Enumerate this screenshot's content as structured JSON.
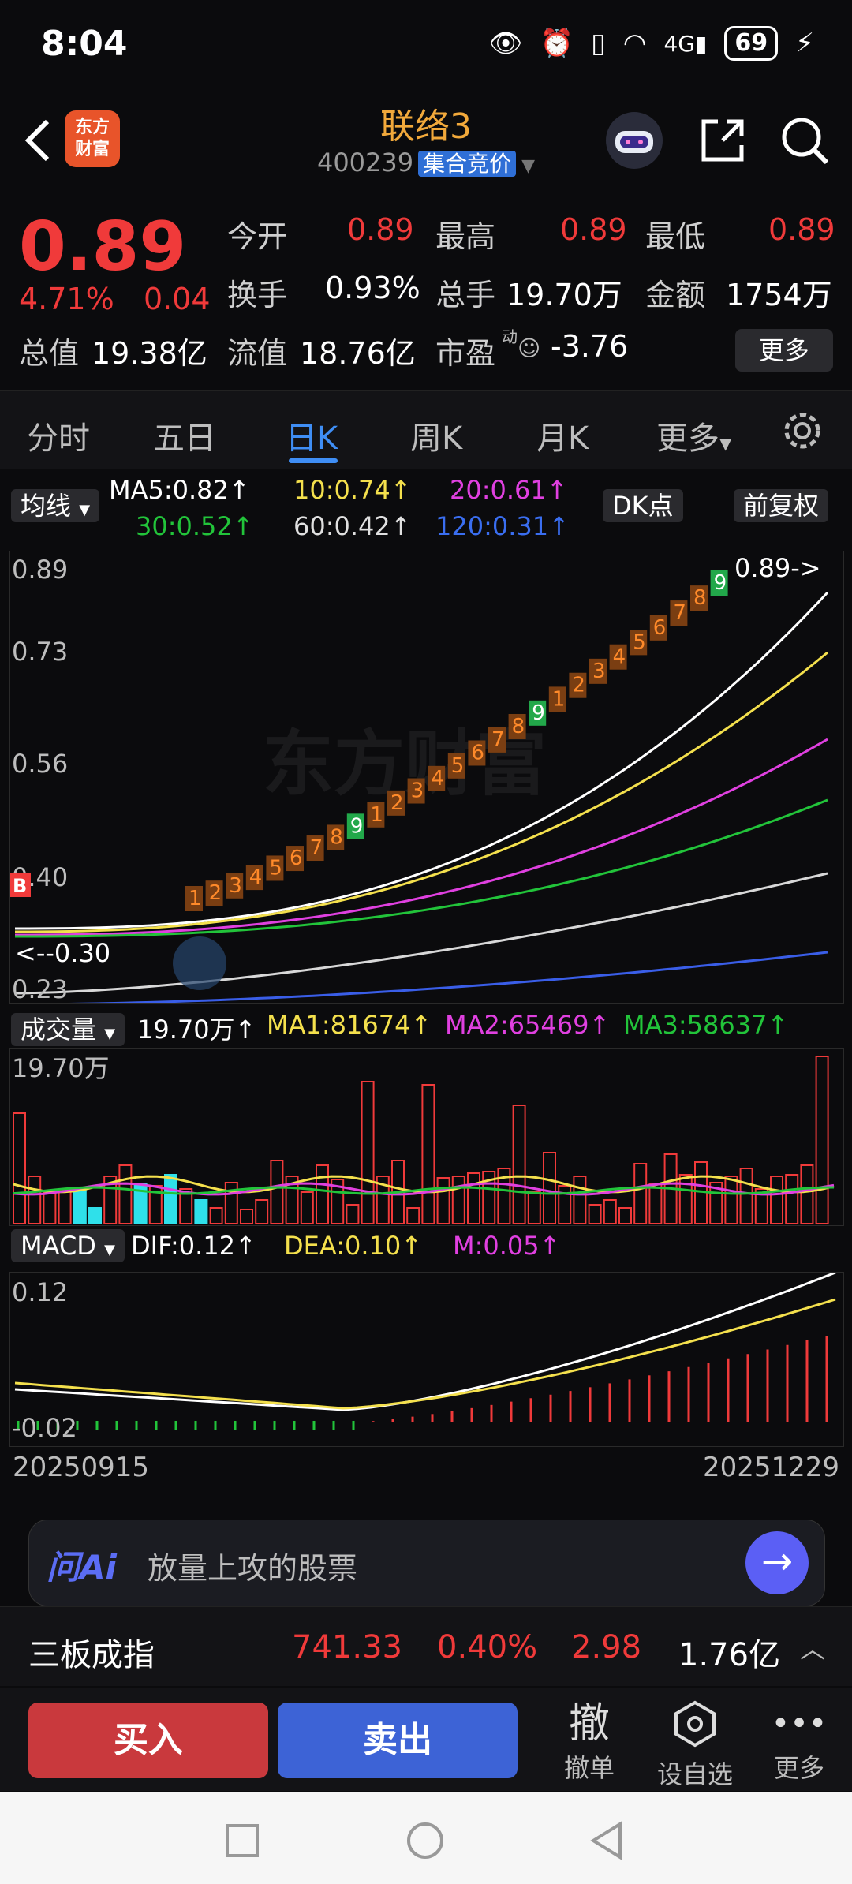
{
  "status_bar": {
    "time": "8:04",
    "battery": "69"
  },
  "header": {
    "logo_text_1": "东方",
    "logo_text_2": "财富",
    "title": "联络3",
    "code": "400239",
    "badge": "集合竞价"
  },
  "quote": {
    "price": "0.89",
    "change_pct": "4.71%",
    "change": "0.04",
    "open_label": "今开",
    "open": "0.89",
    "high_label": "最高",
    "high": "0.89",
    "low_label": "最低",
    "low": "0.89",
    "turnover_label": "换手",
    "turnover": "0.93%",
    "volume_label": "总手",
    "volume": "19.70万",
    "amount_label": "金额",
    "amount": "1754万",
    "mktcap_label": "总值",
    "mktcap": "19.38亿",
    "float_label": "流值",
    "float": "18.76亿",
    "pe_label": "市盈",
    "pe_sup": "动",
    "pe": "-3.76",
    "more": "更多"
  },
  "tabs": [
    "分时",
    "五日",
    "日K",
    "周K",
    "月K",
    "更多"
  ],
  "ma_bar": {
    "selector": "均线",
    "ma5": "MA5:0.82↑",
    "ma10": "10:0.74↑",
    "ma20": "20:0.61↑",
    "ma30": "30:0.52↑",
    "ma60": "60:0.42↑",
    "ma120": "120:0.31↑",
    "dk": "DK点",
    "fq": "前复权"
  },
  "colors": {
    "up": "#f03a3a",
    "down": "#2fe0ea",
    "ma5": "#ffffff",
    "ma10": "#f4e04d",
    "ma20": "#e040e0",
    "ma30": "#22c43a",
    "ma60": "#d8d8d8",
    "ma120": "#3a5ee8",
    "accent": "#3f8ef5"
  },
  "chart": {
    "y_labels": [
      "0.89",
      "0.73",
      "0.56",
      "0.40",
      "0.23"
    ],
    "watermark": "东方财富",
    "last_tag": "0.89->",
    "low_tag": "<--0.30",
    "b_mark": "B",
    "td_counts": [
      "1",
      "2",
      "3",
      "4",
      "5",
      "6",
      "7",
      "8",
      "9",
      "1",
      "2",
      "3",
      "4",
      "5",
      "6",
      "7",
      "8",
      "9",
      "1",
      "2",
      "3",
      "4",
      "5",
      "6",
      "7",
      "8",
      "9"
    ]
  },
  "volume": {
    "selector": "成交量",
    "vol": "19.70万↑",
    "ma1": "MA1:81674↑",
    "ma2": "MA2:65469↑",
    "ma3": "MA3:58637↑",
    "max_label": "19.70万"
  },
  "macd": {
    "selector": "MACD",
    "dif": "DIF:0.12↑",
    "dea": "DEA:0.10↑",
    "m": "M:0.05↑",
    "top_label": "0.12",
    "bottom_label": "-0.02"
  },
  "dates": {
    "start": "20250915",
    "end": "20251229"
  },
  "ai": {
    "brand": "问Ai",
    "placeholder": "放量上攻的股票"
  },
  "index_bar": {
    "name": "三板成指",
    "value": "741.33",
    "pct": "0.40%",
    "chg": "2.98",
    "amount": "1.76亿"
  },
  "actions": {
    "buy": "买入",
    "sell": "卖出",
    "cancel_glyph": "撤",
    "cancel": "撤单",
    "watch": "设自选",
    "more": "更多"
  }
}
